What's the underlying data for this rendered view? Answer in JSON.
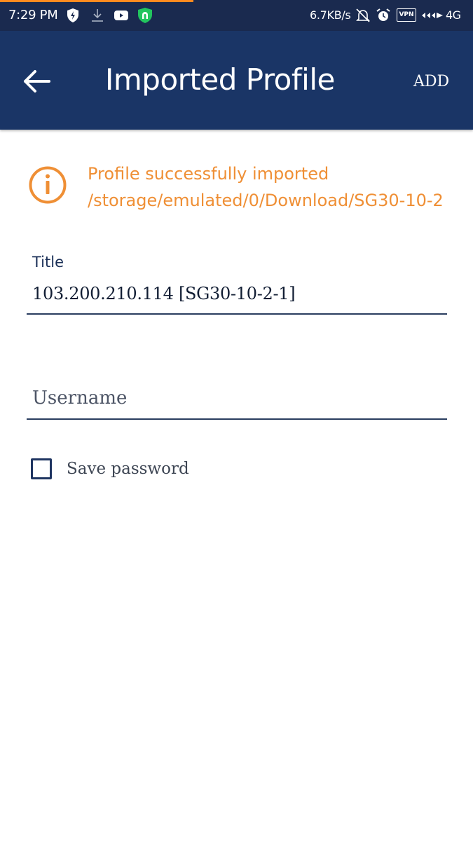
{
  "status_bar": {
    "time": "7:29 PM",
    "speed": "6.7KB/s",
    "vpn": "VPN",
    "network": "4G",
    "icons": [
      "bolt-shield-icon",
      "download-icon",
      "youtube-icon",
      "vpn-shield-icon",
      "mute-bell-icon",
      "alarm-icon",
      "vpn-badge-icon",
      "signal-icon"
    ]
  },
  "app_bar": {
    "title": "Imported Profile",
    "add_label": "ADD",
    "back_icon": "arrow-left-icon"
  },
  "info": {
    "icon": "info-icon",
    "line1": "Profile successfully imported",
    "line2": "/storage/emulated/0/Download/SG30-10-2"
  },
  "form": {
    "title_label": "Title",
    "title_value": "103.200.210.114 [SG30-10-2-1]",
    "username_placeholder": "Username",
    "save_password_label": "Save password",
    "save_password_checked": false
  },
  "colors": {
    "status_bar": "#1a2a4f",
    "app_bar": "#1a3566",
    "accent": "#ef8f35",
    "text_dark": "#1a2f57"
  }
}
